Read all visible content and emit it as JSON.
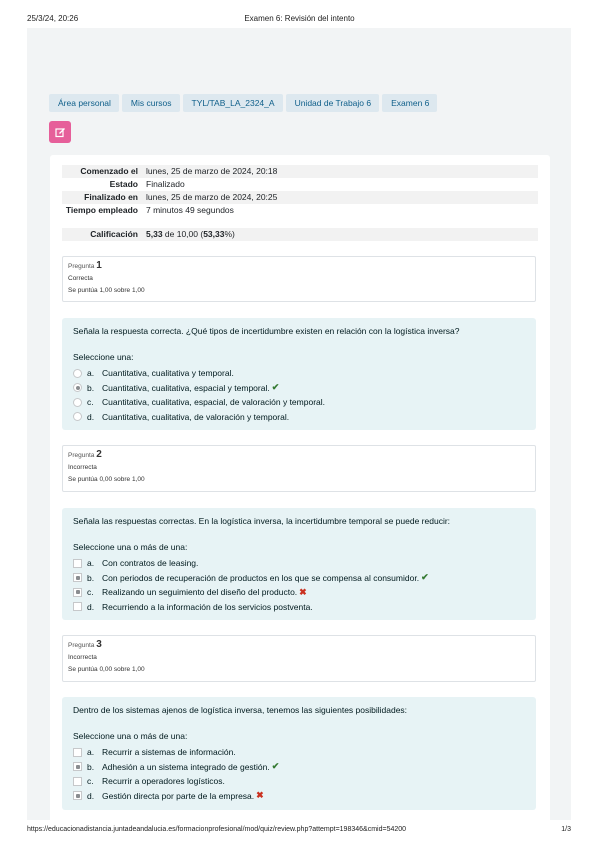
{
  "print_header": {
    "date": "25/3/24, 20:26",
    "title": "Examen 6: Revisión del intento"
  },
  "breadcrumb": [
    "Área personal",
    "Mis cursos",
    "TYL/TAB_LA_2324_A",
    "Unidad de Trabajo 6",
    "Examen 6"
  ],
  "activity_icon": "quiz-edit-icon",
  "summary": {
    "started_label": "Comenzado el",
    "started_value": "lunes, 25 de marzo de 2024, 20:18",
    "state_label": "Estado",
    "state_value": "Finalizado",
    "finished_label": "Finalizado en",
    "finished_value": "lunes, 25 de marzo de 2024, 20:25",
    "time_label": "Tiempo empleado",
    "time_value": "7 minutos 49 segundos",
    "grade_label": "Calificación",
    "grade_score": "5,33",
    "grade_rest": " de 10,00 (",
    "grade_percent": "53,33",
    "grade_end": "%)"
  },
  "questions": [
    {
      "label": "Pregunta",
      "number": "1",
      "status": "Correcta",
      "score": "Se puntúa 1,00 sobre 1,00",
      "text": "Señala la respuesta correcta. ¿Qué tipos de incertidumbre existen en relación con la logística inversa?",
      "prompt": "Seleccione una:",
      "answers": [
        {
          "letter": "a.",
          "text": "Cuantitativa, cualitativa y temporal.",
          "checked": false,
          "feedback": ""
        },
        {
          "letter": "b.",
          "text": "Cuantitativa, cualitativa, espacial y temporal.",
          "checked": true,
          "feedback": "correct"
        },
        {
          "letter": "c.",
          "text": "Cuantitativa, cualitativa, espacial, de valoración y temporal.",
          "checked": false,
          "feedback": ""
        },
        {
          "letter": "d.",
          "text": "Cuantitativa, cualitativa, de valoración y temporal.",
          "checked": false,
          "feedback": ""
        }
      ]
    },
    {
      "label": "Pregunta",
      "number": "2",
      "status": "Incorrecta",
      "score": "Se puntúa 0,00 sobre 1,00",
      "text": "Señala las respuestas correctas. En la logística inversa, la incertidumbre temporal se puede reducir:",
      "prompt": "Seleccione una o más de una:",
      "answers": [
        {
          "letter": "a.",
          "text": "Con contratos de leasing.",
          "checked": false,
          "feedback": ""
        },
        {
          "letter": "b.",
          "text": "Con periodos de recuperación de productos en los que se compensa al consumidor.",
          "checked": true,
          "feedback": "correct"
        },
        {
          "letter": "c.",
          "text": "Realizando un seguimiento del diseño del producto.",
          "checked": true,
          "feedback": "incorrect"
        },
        {
          "letter": "d.",
          "text": "Recurriendo a la información de los servicios postventa.",
          "checked": false,
          "feedback": ""
        }
      ]
    },
    {
      "label": "Pregunta",
      "number": "3",
      "status": "Incorrecta",
      "score": "Se puntúa 0,00 sobre 1,00",
      "text": "Dentro de los sistemas ajenos de logística inversa, tenemos las siguientes posibilidades:",
      "prompt": "Seleccione una o más de una:",
      "answers": [
        {
          "letter": "a.",
          "text": "Recurrir a sistemas de información.",
          "checked": false,
          "feedback": ""
        },
        {
          "letter": "b.",
          "text": "Adhesión a un sistema integrado de gestión.",
          "checked": true,
          "feedback": "correct"
        },
        {
          "letter": "c.",
          "text": "Recurrir a operadores logísticos.",
          "checked": false,
          "feedback": ""
        },
        {
          "letter": "d.",
          "text": "Gestión directa por parte de la empresa.",
          "checked": true,
          "feedback": "incorrect"
        }
      ]
    }
  ],
  "feedback_symbols": {
    "correct": "✔",
    "incorrect": "✖"
  },
  "print_footer": {
    "url": "https://educacionadistancia.juntadeandalucia.es/formacionprofesional/mod/quiz/review.php?attempt=198346&cmid=54200",
    "page": "1/3"
  },
  "colors": {
    "accent": "#0f5f8a",
    "icon_bg": "#e65f9a",
    "question_bg": "#e7f3f5",
    "correct": "#357a32",
    "incorrect": "#ca3120"
  }
}
